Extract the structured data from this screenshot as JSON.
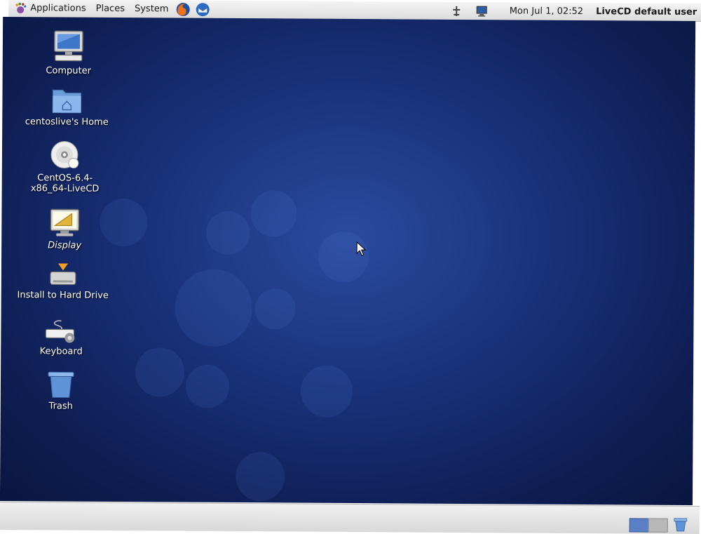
{
  "top_panel": {
    "menus": {
      "applications": "Applications",
      "places": "Places",
      "system": "System"
    },
    "launchers": [
      "firefox-icon",
      "thunderbird-icon"
    ],
    "tray": [
      "network-icon",
      "display-icon"
    ],
    "clock": "Mon Jul  1, 02:52",
    "user": "LiveCD default user"
  },
  "desktop_icons": [
    {
      "label": "Computer",
      "icon": "computer-icon"
    },
    {
      "label": "centoslive's Home",
      "icon": "home-folder-icon"
    },
    {
      "label": "CentOS-6.4-x86_64-LiveCD",
      "icon": "cd-icon"
    },
    {
      "label": "Display",
      "icon": "display-settings-icon"
    },
    {
      "label": "Install to Hard Drive",
      "icon": "install-icon"
    },
    {
      "label": "Keyboard",
      "icon": "keyboard-icon"
    },
    {
      "label": "Trash",
      "icon": "trash-icon"
    }
  ],
  "bottom_panel": {
    "workspaces": [
      "workspace-1",
      "workspace-2"
    ],
    "trash_applet": "trash-icon"
  },
  "colors": {
    "desktop_center": "#2a4b9e",
    "desktop_edge": "#0a1640",
    "panel": "#e6e6e6"
  }
}
